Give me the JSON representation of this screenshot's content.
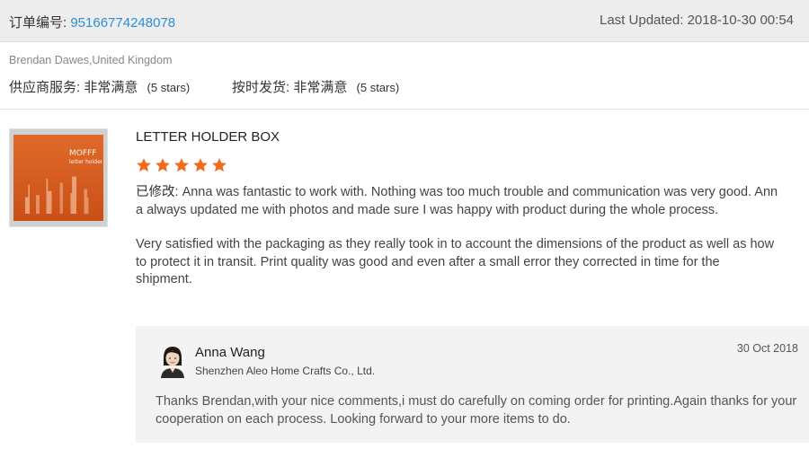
{
  "header": {
    "order_label": "订单编号:",
    "order_number": "95166774248078",
    "last_updated": "Last Updated: 2018-10-30 00:54"
  },
  "buyer": {
    "name_country": "Brendan Dawes,United Kingdom"
  },
  "seller_ratings": [
    {
      "label": "供应商服务:",
      "value": "非常满意",
      "stars_text": "(5 stars)"
    },
    {
      "label": "按时发货:",
      "value": "非常满意",
      "stars_text": "(5 stars)"
    }
  ],
  "product": {
    "title": "LETTER HOLDER BOX",
    "rating": 5,
    "image_icon": "product-box-image",
    "image_logo_text": "MOFFF",
    "image_logo_sub": "letter holder"
  },
  "review": {
    "modified_tag": "已修改:",
    "paragraph1": "Anna was fantastic to work with. Nothing was too much trouble and communication was very good. Anna always updated me with photos and made sure I was happy with product during the whole process.",
    "paragraph2": "Very satisfied with the packaging as they really took in to account the dimensions of the product as well as how to protect it in transit. Print quality was good and even after a small error they corrected in time for the shipment."
  },
  "reply": {
    "name": "Anna Wang",
    "company": "Shenzhen Aleo Home Crafts Co., Ltd.",
    "date": "30 Oct 2018",
    "text": "Thanks Brendan,with your nice comments,i must do carefully on coming order for printing.Again thanks for your cooperation on each process. Looking forward to your more items to do."
  },
  "colors": {
    "link": "#2c8fd6",
    "star": "#f26b1d",
    "header_bg": "#ededed",
    "reply_bg": "#f3f3f3"
  }
}
